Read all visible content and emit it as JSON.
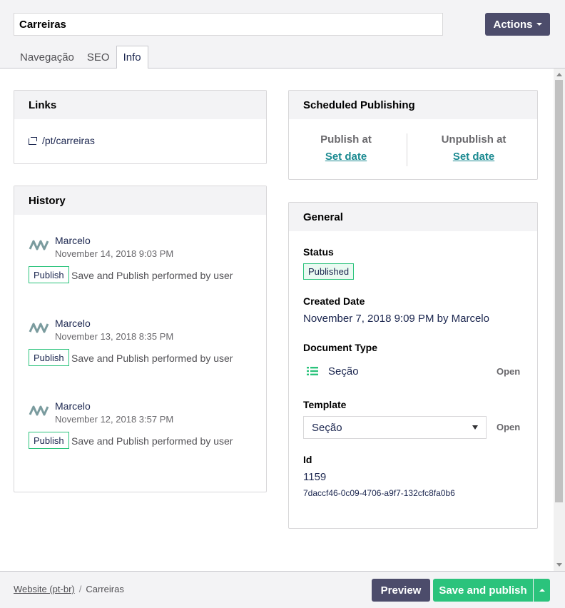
{
  "header": {
    "name_value": "Carreiras",
    "actions_label": "Actions",
    "tabs": [
      {
        "label": "Navegação"
      },
      {
        "label": "SEO"
      },
      {
        "label": "Info"
      }
    ]
  },
  "links": {
    "title": "Links",
    "url": "/pt/carreiras"
  },
  "history": {
    "title": "History",
    "items": [
      {
        "user": "Marcelo",
        "date": "November 14, 2018 9:03 PM",
        "badge": "Publish",
        "description": "Save and Publish performed by user"
      },
      {
        "user": "Marcelo",
        "date": "November 13, 2018 8:35 PM",
        "badge": "Publish",
        "description": "Save and Publish performed by user"
      },
      {
        "user": "Marcelo",
        "date": "November 12, 2018 3:57 PM",
        "badge": "Publish",
        "description": "Save and Publish performed by user"
      }
    ]
  },
  "scheduled": {
    "title": "Scheduled Publishing",
    "publish_label": "Publish at",
    "publish_link": "Set date",
    "unpublish_label": "Unpublish at",
    "unpublish_link": "Set date"
  },
  "general": {
    "title": "General",
    "status_label": "Status",
    "status_value": "Published",
    "created_label": "Created Date",
    "created_value": "November 7, 2018 9:09 PM by Marcelo",
    "doctype_label": "Document Type",
    "doctype_value": "Seção",
    "doctype_open": "Open",
    "template_label": "Template",
    "template_value": "Seção",
    "template_open": "Open",
    "id_label": "Id",
    "id_value": "1159",
    "key_value": "7daccf46-0c09-4706-a9f7-132cfc8fa0b6"
  },
  "footer": {
    "breadcrumb_root": "Website (pt-br)",
    "breadcrumb_separator": "/",
    "breadcrumb_current": "Carreiras",
    "preview_label": "Preview",
    "save_publish_label": "Save and publish"
  },
  "colors": {
    "primary_button": "#4c4c6b",
    "success": "#2bc37c",
    "text": "#1b264f"
  }
}
